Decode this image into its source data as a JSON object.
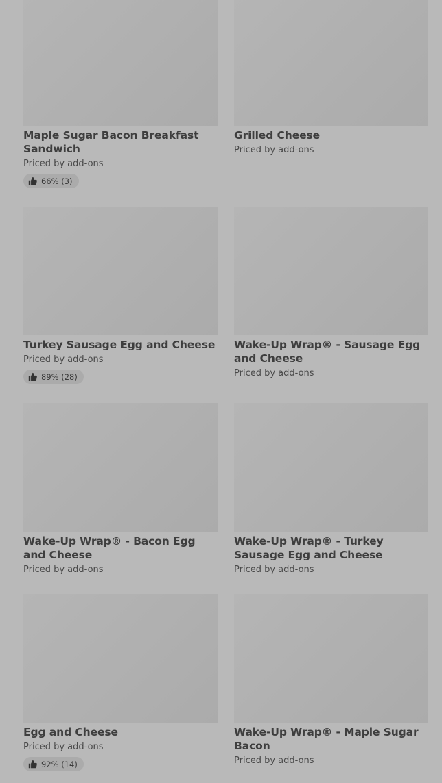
{
  "items": [
    {
      "name": "Maple Sugar Bacon Breakfast Sandwich",
      "price": "Priced by add-ons",
      "rating": "66% (3)"
    },
    {
      "name": "Grilled Cheese",
      "price": "Priced by add-ons"
    },
    {
      "name": "Turkey Sausage Egg and Cheese",
      "price": "Priced by add-ons",
      "rating": "89% (28)"
    },
    {
      "name": "Wake-Up Wrap® - Sausage Egg and Cheese",
      "price": "Priced by add-ons"
    },
    {
      "name": "Wake-Up Wrap® - Bacon Egg and Cheese",
      "price": "Priced by add-ons"
    },
    {
      "name": "Wake-Up Wrap® - Turkey Sausage Egg and Cheese",
      "price": "Priced by add-ons"
    },
    {
      "name": "Egg and Cheese",
      "price": "Priced by add-ons",
      "rating": "92% (14)"
    },
    {
      "name": "Wake-Up Wrap® - Maple Sugar Bacon",
      "price": "Priced by add-ons"
    }
  ],
  "icons": {
    "rating": "thumbs-up-icon"
  }
}
